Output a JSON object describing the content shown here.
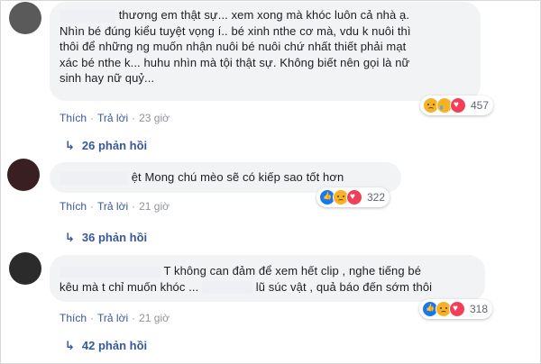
{
  "actions": {
    "like": "Thích",
    "reply": "Trả lời",
    "dot": "·"
  },
  "comments": [
    {
      "lines": [
        "thương em thật sự... xem xong mà khóc luôn cả nhà ạ.",
        "Nhìn bé đúng kiểu tuyệt vọng í.. bé xinh nthe cơ mà, vdu k nuôi thì",
        "thôi để những ng muốn nhận nuôi bé nuôi chứ nhất thiết phải mạt",
        "xác bé nthe k... huhu nhìn mà tội thật sự. Không biết nên gọi là nữ",
        "sinh hay nữ quỷ..."
      ],
      "time": "23 giờ",
      "reaction_count": "457",
      "replies": "26 phản hồi"
    },
    {
      "lines": [
        "ệt Mong chú mèo sẽ có kiếp sao tốt hơn"
      ],
      "time": "21 giờ",
      "reaction_count": "322",
      "replies": "36 phản hồi"
    },
    {
      "lines": [
        "T không can đảm để xem hết clip , nghe tiếng bé",
        "kêu mà t chỉ muốn khóc ...",
        "lũ súc vật , quả báo đến sớm thôi"
      ],
      "time": "21 giờ",
      "reaction_count": "318",
      "replies": "42 phản hồi"
    }
  ],
  "icons": {
    "reply_arrow": "reply-arrow-icon",
    "reactions": [
      "sad-icon",
      "cry-icon",
      "like-icon",
      "love-icon"
    ]
  },
  "colors": {
    "link": "#385898",
    "bubble": "#f2f3f5",
    "meta": "#90949c"
  }
}
